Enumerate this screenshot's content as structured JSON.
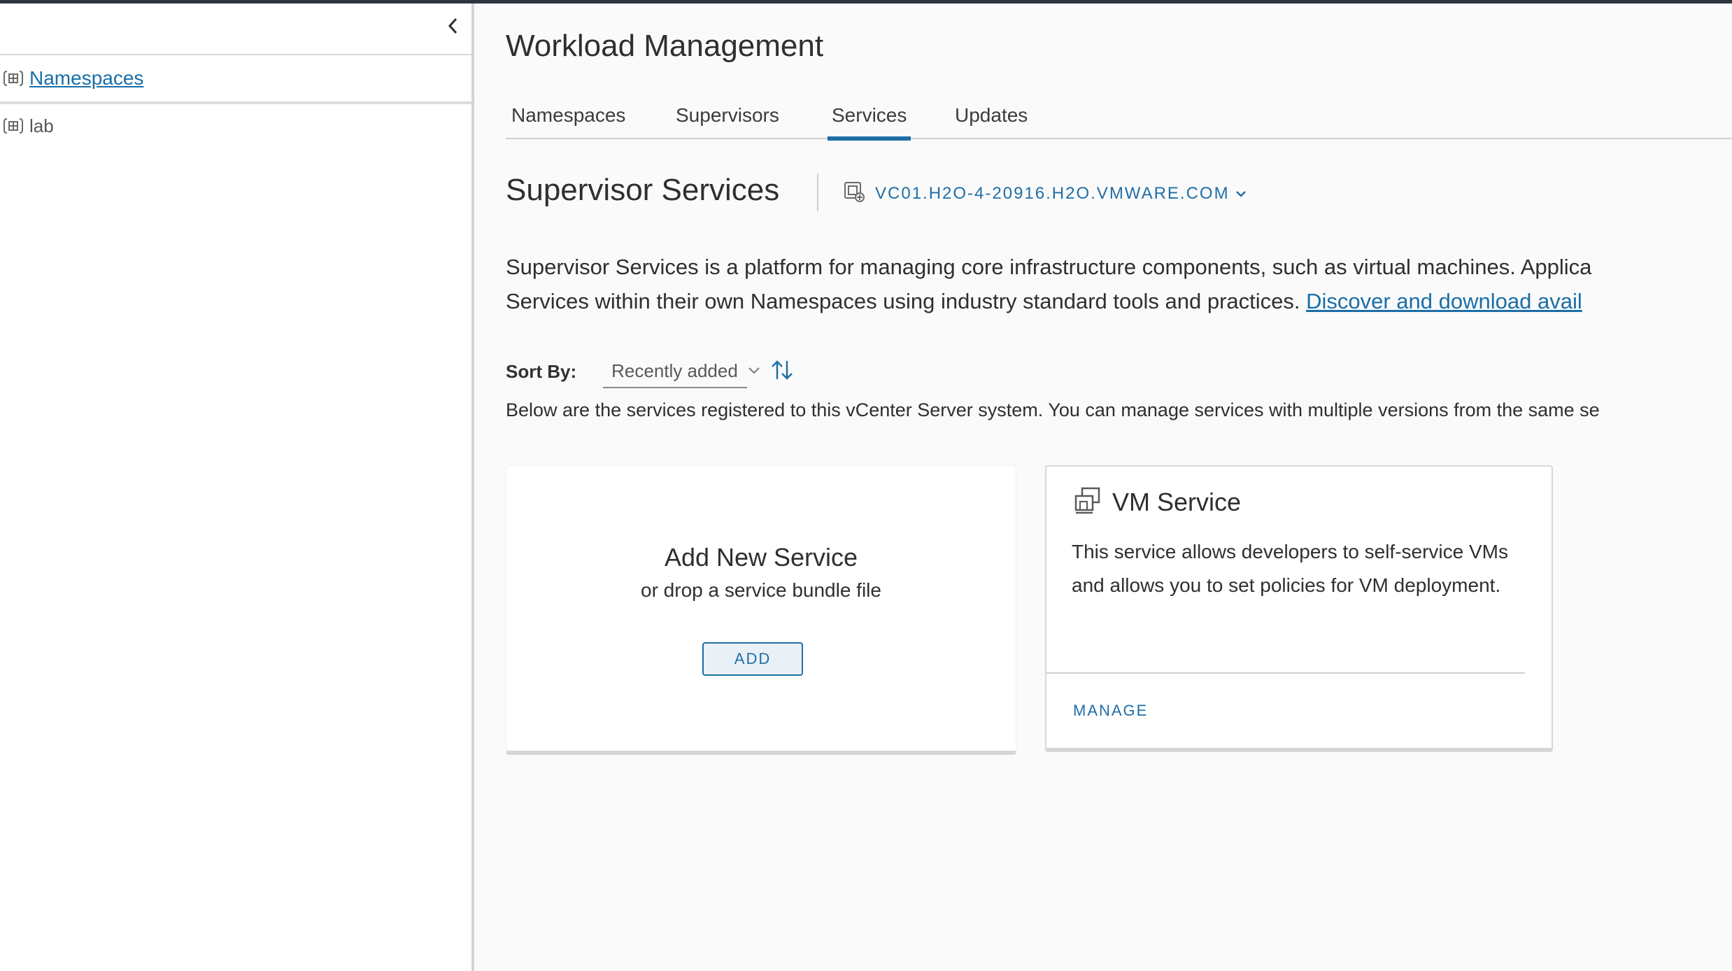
{
  "colors": {
    "accent": "#1f6ea6",
    "link": "#1a6ea8",
    "topbar": "#2b3640"
  },
  "sidebar": {
    "collapse_icon": "chevron-left-icon",
    "tree": {
      "root": {
        "label": " Namespaces",
        "icon": "namespace-icon"
      },
      "children": [
        {
          "label": "lab",
          "icon": "namespace-icon"
        }
      ]
    }
  },
  "main": {
    "title": "Workload Management",
    "tabs": [
      {
        "label": "Namespaces",
        "active": false
      },
      {
        "label": "Supervisors",
        "active": false
      },
      {
        "label": "Services",
        "active": true
      },
      {
        "label": "Updates",
        "active": false
      }
    ],
    "section_title": "Supervisor Services",
    "vcenter": {
      "icon": "vcenter-icon",
      "name": "VC01.H2O-4-20916.H2O.VMWARE.COM",
      "dropdown_icon": "chevron-down-icon"
    },
    "description": {
      "line1": "Supervisor Services is a platform for managing core infrastructure components, such as virtual machines. Applica",
      "line2": "Services within their own Namespaces using industry standard tools and practices. ",
      "link": "Discover and download avail"
    },
    "sort": {
      "label": "Sort By:",
      "value": "Recently added",
      "order_icon": "sort-order-icon"
    },
    "info_text": "Below are the services registered to this vCenter Server system. You can manage services with multiple versions from the same se",
    "add_card": {
      "title": "Add New Service",
      "subtitle": "or drop a service bundle file",
      "button": "ADD"
    },
    "service_cards": [
      {
        "icon": "vm-service-icon",
        "title": "VM Service",
        "description": "This service allows developers to self-service VMs and allows you to set policies for VM deployment.",
        "action": "MANAGE"
      }
    ]
  }
}
